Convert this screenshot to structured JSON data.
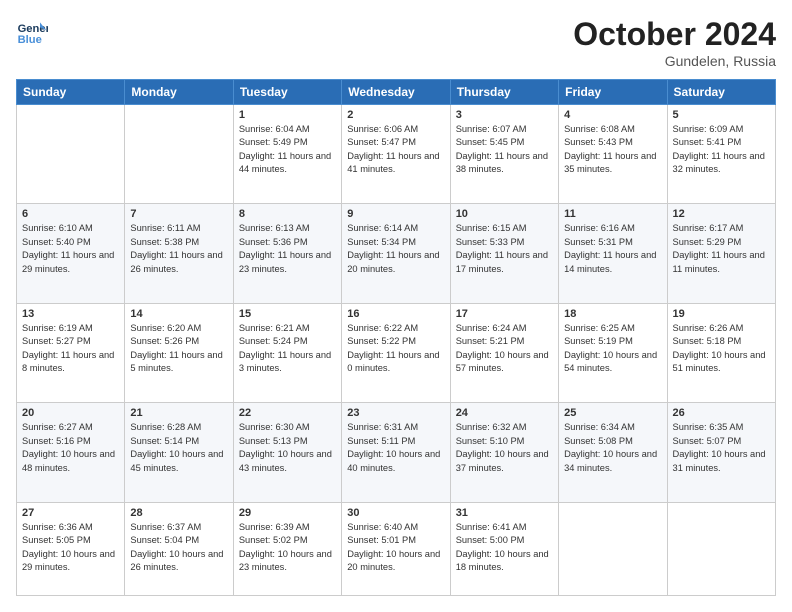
{
  "header": {
    "logo_line1": "General",
    "logo_line2": "Blue",
    "month": "October 2024",
    "location": "Gundelen, Russia"
  },
  "weekdays": [
    "Sunday",
    "Monday",
    "Tuesday",
    "Wednesday",
    "Thursday",
    "Friday",
    "Saturday"
  ],
  "weeks": [
    [
      {
        "day": "",
        "info": ""
      },
      {
        "day": "",
        "info": ""
      },
      {
        "day": "1",
        "info": "Sunrise: 6:04 AM\nSunset: 5:49 PM\nDaylight: 11 hours and 44 minutes."
      },
      {
        "day": "2",
        "info": "Sunrise: 6:06 AM\nSunset: 5:47 PM\nDaylight: 11 hours and 41 minutes."
      },
      {
        "day": "3",
        "info": "Sunrise: 6:07 AM\nSunset: 5:45 PM\nDaylight: 11 hours and 38 minutes."
      },
      {
        "day": "4",
        "info": "Sunrise: 6:08 AM\nSunset: 5:43 PM\nDaylight: 11 hours and 35 minutes."
      },
      {
        "day": "5",
        "info": "Sunrise: 6:09 AM\nSunset: 5:41 PM\nDaylight: 11 hours and 32 minutes."
      }
    ],
    [
      {
        "day": "6",
        "info": "Sunrise: 6:10 AM\nSunset: 5:40 PM\nDaylight: 11 hours and 29 minutes."
      },
      {
        "day": "7",
        "info": "Sunrise: 6:11 AM\nSunset: 5:38 PM\nDaylight: 11 hours and 26 minutes."
      },
      {
        "day": "8",
        "info": "Sunrise: 6:13 AM\nSunset: 5:36 PM\nDaylight: 11 hours and 23 minutes."
      },
      {
        "day": "9",
        "info": "Sunrise: 6:14 AM\nSunset: 5:34 PM\nDaylight: 11 hours and 20 minutes."
      },
      {
        "day": "10",
        "info": "Sunrise: 6:15 AM\nSunset: 5:33 PM\nDaylight: 11 hours and 17 minutes."
      },
      {
        "day": "11",
        "info": "Sunrise: 6:16 AM\nSunset: 5:31 PM\nDaylight: 11 hours and 14 minutes."
      },
      {
        "day": "12",
        "info": "Sunrise: 6:17 AM\nSunset: 5:29 PM\nDaylight: 11 hours and 11 minutes."
      }
    ],
    [
      {
        "day": "13",
        "info": "Sunrise: 6:19 AM\nSunset: 5:27 PM\nDaylight: 11 hours and 8 minutes."
      },
      {
        "day": "14",
        "info": "Sunrise: 6:20 AM\nSunset: 5:26 PM\nDaylight: 11 hours and 5 minutes."
      },
      {
        "day": "15",
        "info": "Sunrise: 6:21 AM\nSunset: 5:24 PM\nDaylight: 11 hours and 3 minutes."
      },
      {
        "day": "16",
        "info": "Sunrise: 6:22 AM\nSunset: 5:22 PM\nDaylight: 11 hours and 0 minutes."
      },
      {
        "day": "17",
        "info": "Sunrise: 6:24 AM\nSunset: 5:21 PM\nDaylight: 10 hours and 57 minutes."
      },
      {
        "day": "18",
        "info": "Sunrise: 6:25 AM\nSunset: 5:19 PM\nDaylight: 10 hours and 54 minutes."
      },
      {
        "day": "19",
        "info": "Sunrise: 6:26 AM\nSunset: 5:18 PM\nDaylight: 10 hours and 51 minutes."
      }
    ],
    [
      {
        "day": "20",
        "info": "Sunrise: 6:27 AM\nSunset: 5:16 PM\nDaylight: 10 hours and 48 minutes."
      },
      {
        "day": "21",
        "info": "Sunrise: 6:28 AM\nSunset: 5:14 PM\nDaylight: 10 hours and 45 minutes."
      },
      {
        "day": "22",
        "info": "Sunrise: 6:30 AM\nSunset: 5:13 PM\nDaylight: 10 hours and 43 minutes."
      },
      {
        "day": "23",
        "info": "Sunrise: 6:31 AM\nSunset: 5:11 PM\nDaylight: 10 hours and 40 minutes."
      },
      {
        "day": "24",
        "info": "Sunrise: 6:32 AM\nSunset: 5:10 PM\nDaylight: 10 hours and 37 minutes."
      },
      {
        "day": "25",
        "info": "Sunrise: 6:34 AM\nSunset: 5:08 PM\nDaylight: 10 hours and 34 minutes."
      },
      {
        "day": "26",
        "info": "Sunrise: 6:35 AM\nSunset: 5:07 PM\nDaylight: 10 hours and 31 minutes."
      }
    ],
    [
      {
        "day": "27",
        "info": "Sunrise: 6:36 AM\nSunset: 5:05 PM\nDaylight: 10 hours and 29 minutes."
      },
      {
        "day": "28",
        "info": "Sunrise: 6:37 AM\nSunset: 5:04 PM\nDaylight: 10 hours and 26 minutes."
      },
      {
        "day": "29",
        "info": "Sunrise: 6:39 AM\nSunset: 5:02 PM\nDaylight: 10 hours and 23 minutes."
      },
      {
        "day": "30",
        "info": "Sunrise: 6:40 AM\nSunset: 5:01 PM\nDaylight: 10 hours and 20 minutes."
      },
      {
        "day": "31",
        "info": "Sunrise: 6:41 AM\nSunset: 5:00 PM\nDaylight: 10 hours and 18 minutes."
      },
      {
        "day": "",
        "info": ""
      },
      {
        "day": "",
        "info": ""
      }
    ]
  ]
}
